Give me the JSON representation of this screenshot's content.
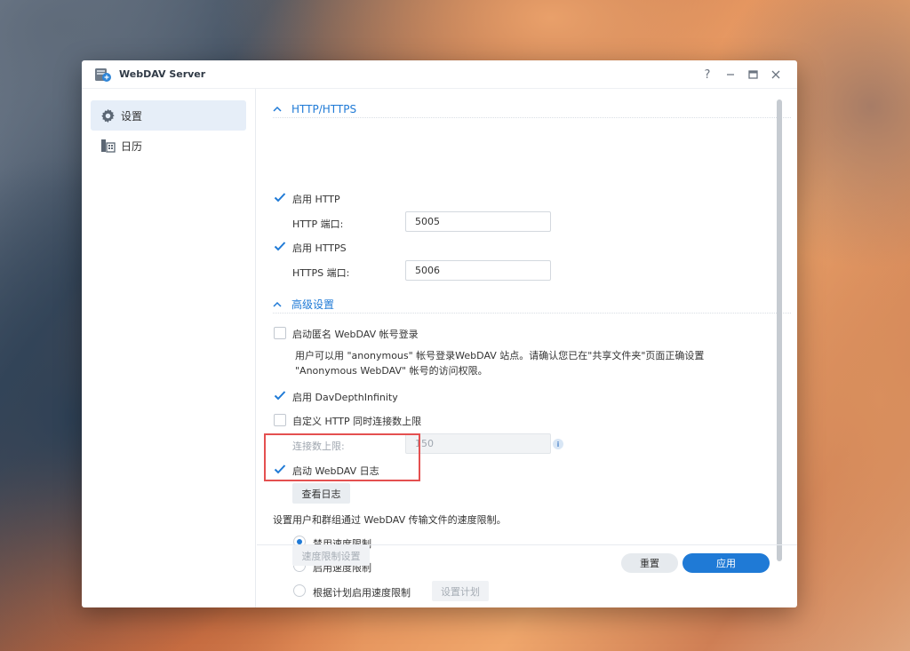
{
  "window": {
    "title": "WebDAV Server",
    "controls": {
      "help": "?",
      "minimize": "—",
      "maximize": "□",
      "close": "✕"
    }
  },
  "sidebar": {
    "items": [
      {
        "label": "设置",
        "icon": "gear-icon",
        "active": true
      },
      {
        "label": "日历",
        "icon": "calendar-icon",
        "active": false
      }
    ]
  },
  "main": {
    "http_section": {
      "title": "HTTP/HTTPS",
      "enable_http": {
        "label": "启用 HTTP",
        "checked": true
      },
      "http_port": {
        "label": "HTTP 端口:",
        "value": "5005"
      },
      "enable_https": {
        "label": "启用 HTTPS",
        "checked": true
      },
      "https_port": {
        "label": "HTTPS 端口:",
        "value": "5006"
      }
    },
    "advanced_section": {
      "title": "高级设置",
      "anonymous_login": {
        "label": "启动匿名 WebDAV 帐号登录",
        "checked": false
      },
      "anonymous_desc": "用户可以用 \"anonymous\" 帐号登录WebDAV 站点。请确认您已在\"共享文件夹\"页面正确设置 \"Anonymous WebDAV\" 帐号的访问权限。",
      "dav_depth_infinity": {
        "label": "启用 DavDepthInfinity",
        "checked": true
      },
      "custom_http_limit": {
        "label": "自定义 HTTP 同时连接数上限",
        "checked": false
      },
      "connection_limit": {
        "label": "连接数上限:",
        "value": "150"
      },
      "webdav_log": {
        "label": "启动 WebDAV 日志",
        "checked": true
      },
      "view_log_button": "查看日志",
      "speed_limit_desc": "设置用户和群组通过 WebDAV 传输文件的速度限制。",
      "speed_options": [
        {
          "label": "禁用速度限制",
          "selected": true
        },
        {
          "label": "启用速度限制",
          "selected": false
        },
        {
          "label": "根据计划启用速度限制",
          "selected": false
        }
      ],
      "schedule_button": "设置计划",
      "speed_settings_button": "速度限制设置"
    }
  },
  "footer": {
    "reset_label": "重置",
    "apply_label": "应用"
  },
  "colors": {
    "accent": "#1f7ad6",
    "highlight": "#e45050"
  }
}
